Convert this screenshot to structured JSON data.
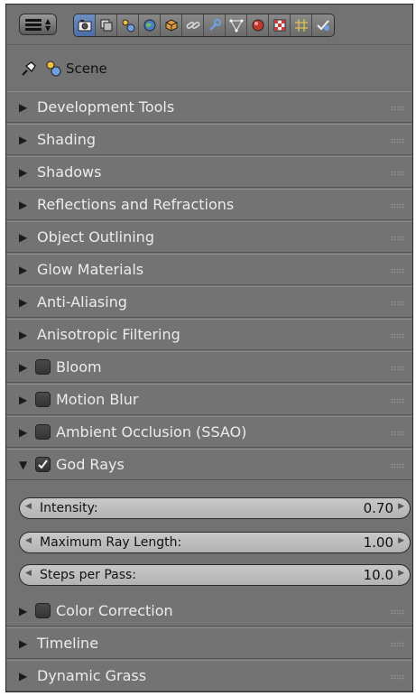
{
  "toolbar": {
    "tabs": [
      "render-icon",
      "render-layers-icon",
      "scene-icon",
      "world-icon",
      "object-icon",
      "constraints-icon",
      "modifiers-icon",
      "data-icon",
      "material-icon",
      "texture-icon",
      "particles-icon",
      "physics-icon"
    ],
    "active_tab": "render-icon"
  },
  "scene": {
    "label": "Scene"
  },
  "panels": [
    {
      "label": "Development Tools",
      "checkbox": false,
      "expanded": false
    },
    {
      "label": "Shading",
      "checkbox": false,
      "expanded": false
    },
    {
      "label": "Shadows",
      "checkbox": false,
      "expanded": false
    },
    {
      "label": "Reflections and Refractions",
      "checkbox": false,
      "expanded": false
    },
    {
      "label": "Object Outlining",
      "checkbox": false,
      "expanded": false
    },
    {
      "label": "Glow Materials",
      "checkbox": false,
      "expanded": false
    },
    {
      "label": "Anti-Aliasing",
      "checkbox": false,
      "expanded": false
    },
    {
      "label": "Anisotropic Filtering",
      "checkbox": false,
      "expanded": false
    },
    {
      "label": "Bloom",
      "checkbox": true,
      "checked": false,
      "expanded": false
    },
    {
      "label": "Motion Blur",
      "checkbox": true,
      "checked": false,
      "expanded": false
    },
    {
      "label": "Ambient Occlusion (SSAO)",
      "checkbox": true,
      "checked": false,
      "expanded": false
    },
    {
      "label": "God Rays",
      "checkbox": true,
      "checked": true,
      "expanded": true
    },
    {
      "label": "Color Correction",
      "checkbox": true,
      "checked": false,
      "expanded": false
    },
    {
      "label": "Timeline",
      "checkbox": false,
      "expanded": false
    },
    {
      "label": "Dynamic Grass",
      "checkbox": false,
      "expanded": false
    }
  ],
  "god_rays": {
    "intensity_label": "Intensity:",
    "intensity_value": "0.70",
    "max_ray_length_label": "Maximum Ray Length:",
    "max_ray_length_value": "1.00",
    "steps_label": "Steps per Pass:",
    "steps_value": "10.0"
  }
}
